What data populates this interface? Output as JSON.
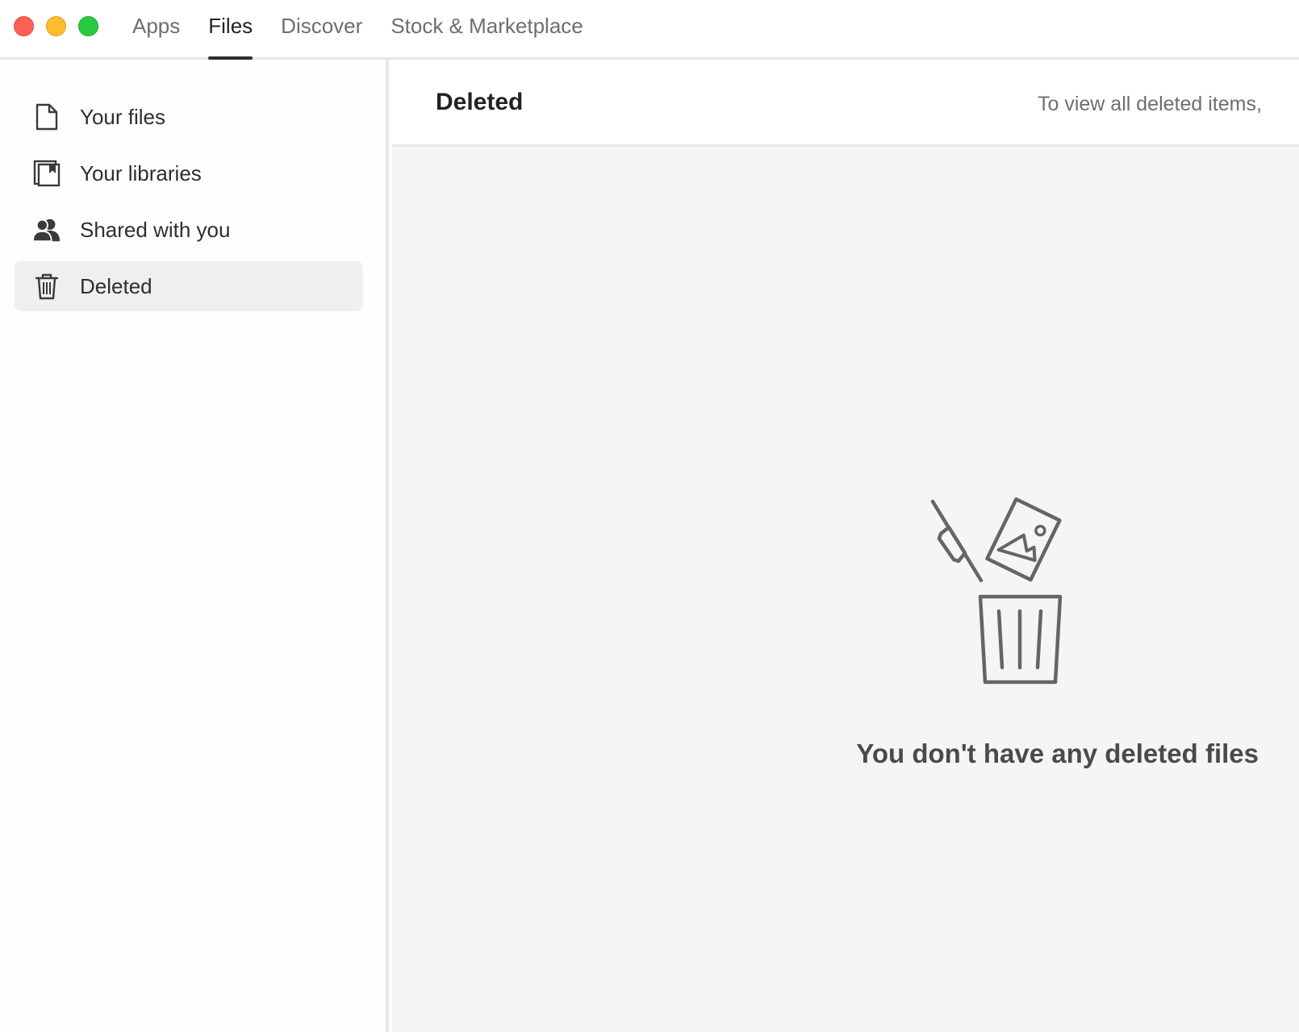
{
  "window": {
    "controls": [
      "close",
      "minimize",
      "maximize"
    ]
  },
  "tabs": [
    {
      "label": "Apps",
      "active": false
    },
    {
      "label": "Files",
      "active": true
    },
    {
      "label": "Discover",
      "active": false
    },
    {
      "label": "Stock & Marketplace",
      "active": false
    }
  ],
  "sidebar": {
    "items": [
      {
        "label": "Your files",
        "icon": "file-icon",
        "selected": false
      },
      {
        "label": "Your libraries",
        "icon": "libraries-icon",
        "selected": false
      },
      {
        "label": "Shared with you",
        "icon": "people-icon",
        "selected": false
      },
      {
        "label": "Deleted",
        "icon": "trash-icon",
        "selected": true
      }
    ]
  },
  "main": {
    "title": "Deleted",
    "hint": "To view all deleted items,",
    "empty_state": {
      "icon": "empty-trash-illustration",
      "message": "You don't have any deleted files"
    }
  },
  "colors": {
    "close": "#fe5f57",
    "minimize": "#febc2e",
    "maximize": "#28c840",
    "selected_bg": "#efefef",
    "content_bg": "#f5f5f5"
  }
}
